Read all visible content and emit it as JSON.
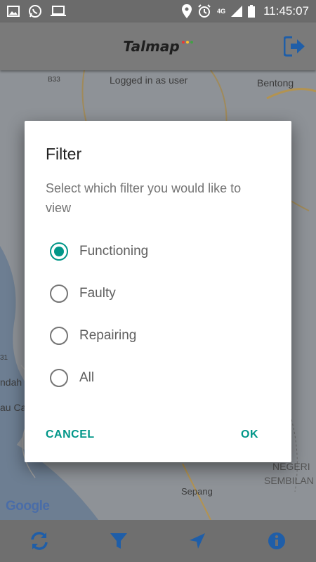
{
  "status_bar": {
    "time": "11:45:07",
    "network": "4G",
    "icons_left": [
      "image-icon",
      "whatsapp-icon",
      "laptop-icon"
    ],
    "icons_right": [
      "location-icon",
      "alarm-icon",
      "signal-icon",
      "battery-icon"
    ]
  },
  "app_bar": {
    "logo_text": "Talmap",
    "logo_dot_colors": [
      "#e53935",
      "#fbc02d",
      "#43a047"
    ]
  },
  "map": {
    "overlay_text": "Logged in as user",
    "labels": [
      "Bentong",
      "Sepang",
      "NEGERI",
      "SEMBILAN",
      "B33",
      "ndah",
      "au Ca",
      "31"
    ],
    "attribution": "Google"
  },
  "dialog": {
    "title": "Filter",
    "message": "Select which filter you would like to view",
    "options": [
      {
        "label": "Functioning",
        "checked": true
      },
      {
        "label": "Faulty",
        "checked": false
      },
      {
        "label": "Repairing",
        "checked": false
      },
      {
        "label": "All",
        "checked": false
      }
    ],
    "cancel_label": "CANCEL",
    "ok_label": "OK"
  },
  "bottom_bar": {
    "items": [
      "refresh-icon",
      "filter-icon",
      "navigation-icon",
      "info-icon"
    ]
  },
  "colors": {
    "accent": "#009688",
    "icon_blue": "#1f5ea8"
  }
}
